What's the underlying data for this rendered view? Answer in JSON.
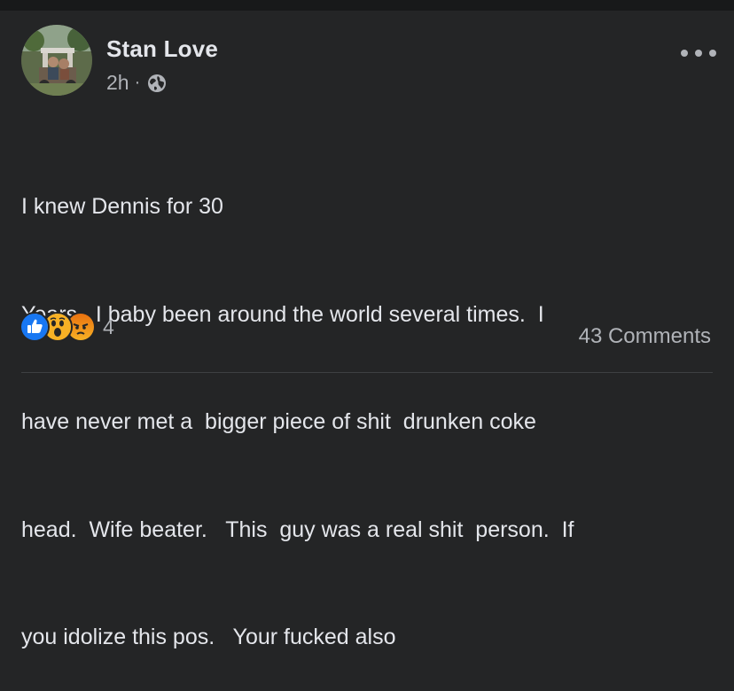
{
  "post": {
    "author": "Stan Love",
    "time": "2h",
    "separator": "·",
    "audience_icon": "globe-icon",
    "more_icon": "more-options-icon",
    "message_lines": [
      "I knew Dennis for 30",
      "Years   I baby been around the world several times.  I",
      "have never met a  bigger piece of shit  drunken coke",
      "head.  Wife beater.   This  guy was a real shit  person.  If",
      "you idolize this pos.   Your fucked also"
    ],
    "reactions": {
      "icons": [
        "like-icon",
        "wow-icon",
        "angry-icon"
      ],
      "count": "4"
    },
    "comments_label": "43 Comments"
  },
  "colors": {
    "background": "#242526",
    "divider": "#18191a",
    "text_primary": "#e4e6eb",
    "text_secondary": "#b0b3b8",
    "like_blue": "#1877f2",
    "reaction_yellow": "#f7b125",
    "angry_orange": "#e9710f"
  }
}
